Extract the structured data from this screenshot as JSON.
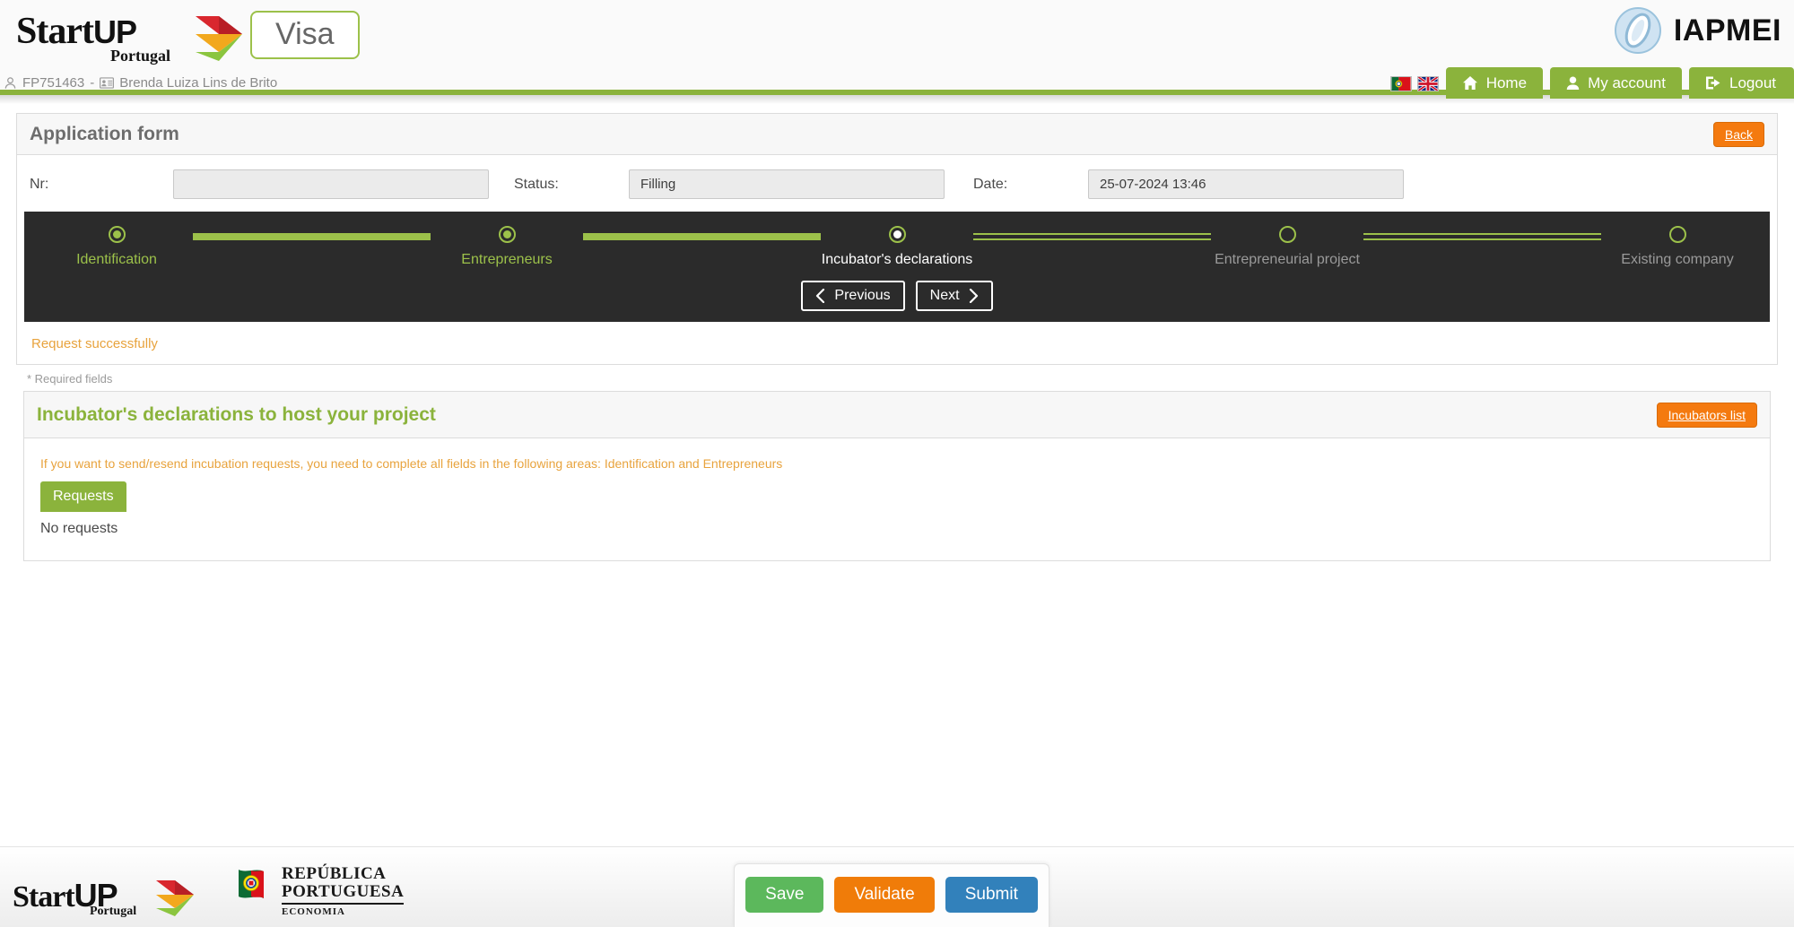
{
  "header": {
    "brand_name": "StartUP",
    "brand_name_bold": "UP",
    "brand_sub": "Portugal",
    "visa_badge": "Visa",
    "org_logo_text": "IAPMEI",
    "user_id": "FP751463",
    "user_separator": "-",
    "user_name": "Brenda Luiza Lins de Brito",
    "flags": [
      {
        "name": "portugal-flag-icon",
        "title": "Português"
      },
      {
        "name": "uk-flag-icon",
        "title": "English"
      }
    ],
    "nav": [
      {
        "label": "Home",
        "icon": "home-icon"
      },
      {
        "label": "My account",
        "icon": "user-icon"
      },
      {
        "label": "Logout",
        "icon": "logout-icon"
      }
    ]
  },
  "form_panel": {
    "title": "Application form",
    "back_label": "Back",
    "fields": {
      "nr_label": "Nr:",
      "nr_value": "",
      "status_label": "Status:",
      "status_value": "Filling",
      "date_label": "Date:",
      "date_value": "25-07-2024 13:46"
    },
    "success_message": "Request successfully"
  },
  "stepper": {
    "steps": [
      {
        "label": "Identification",
        "state": "done"
      },
      {
        "label": "Entrepreneurs",
        "state": "done"
      },
      {
        "label": "Incubator's declarations",
        "state": "active"
      },
      {
        "label": "Entrepreneurial project",
        "state": "todo"
      },
      {
        "label": "Existing company",
        "state": "todo"
      }
    ],
    "previous_label": "Previous",
    "next_label": "Next"
  },
  "required_note": "* Required fields",
  "incubator_panel": {
    "title": "Incubator's declarations to host your project",
    "list_button_label": "Incubators list",
    "warning": "If you want to send/resend incubation requests, you need to complete all fields in the following areas: Identification and Entrepreneurs",
    "requests_tab_label": "Requests",
    "empty_state": "No requests"
  },
  "footer": {
    "brand_name": "Start",
    "brand_name_bold": "UP",
    "brand_sub": "Portugal",
    "republic_line1": "REPÚBLICA",
    "republic_line2": "PORTUGUESA",
    "republic_line3": "ECONOMIA",
    "actions": [
      {
        "label": "Save",
        "kind": "save"
      },
      {
        "label": "Validate",
        "kind": "validate"
      },
      {
        "label": "Submit",
        "kind": "submit"
      }
    ]
  },
  "colors": {
    "green": "#8bb33c",
    "green_light": "#9cc14a",
    "orange": "#f47a0f",
    "warn_orange": "#e8a33d",
    "blue": "#3281bb",
    "dark": "#2b2b2b"
  }
}
